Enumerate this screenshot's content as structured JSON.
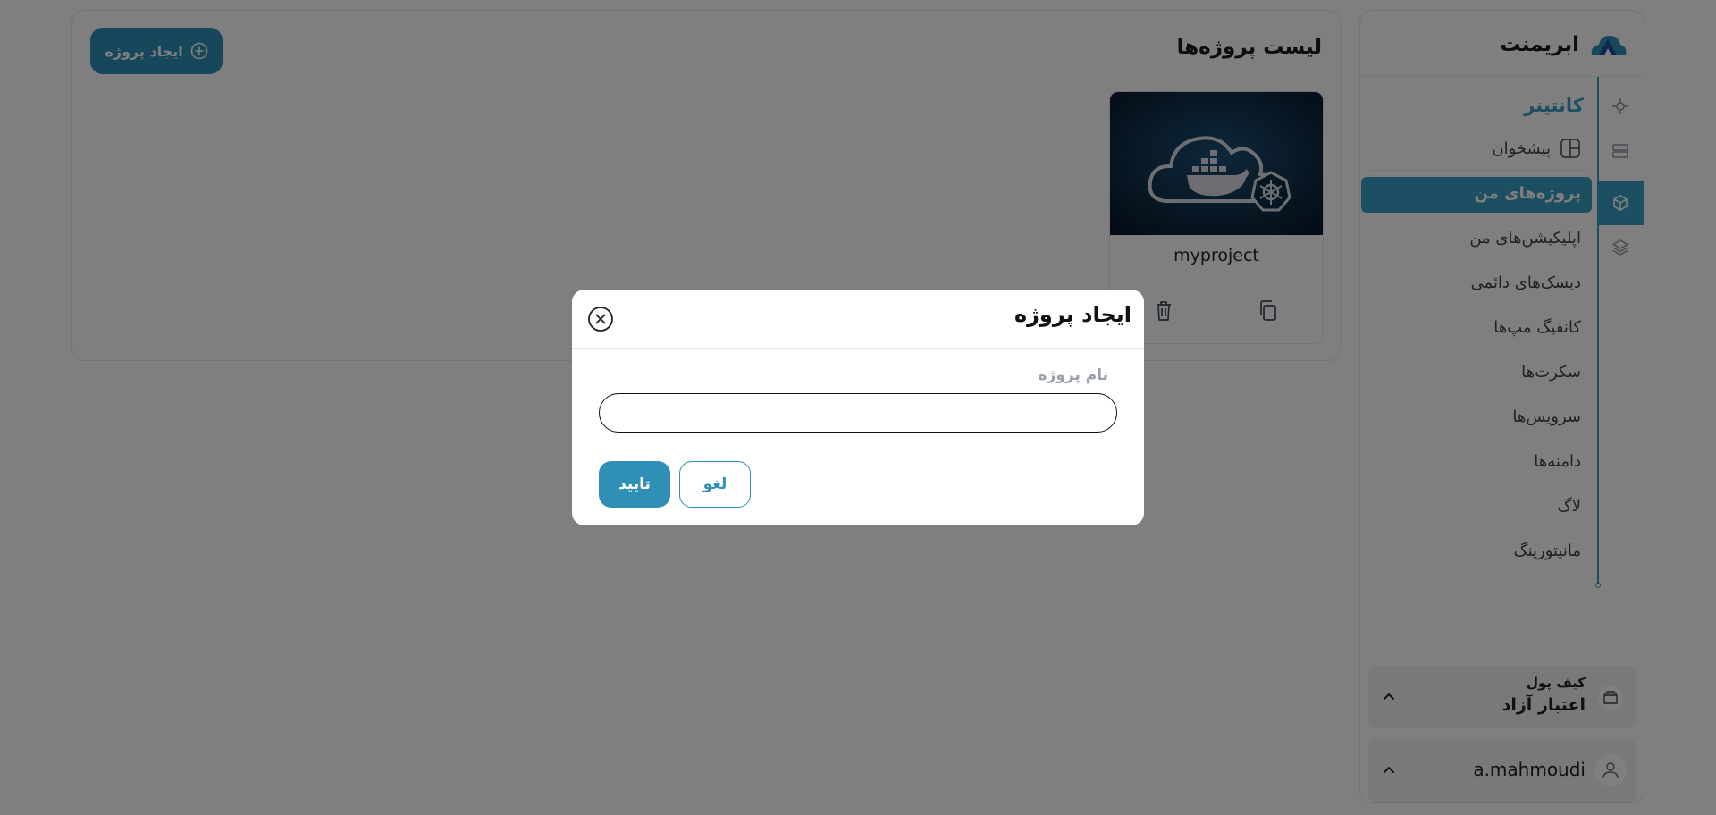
{
  "brand": {
    "name": "ابریمنت",
    "logo_icon": "abriment-logo-icon"
  },
  "colors": {
    "accent": "#3a9ec5",
    "button": "#2f8fb4",
    "overlay": "rgba(0,0,0,0.5)"
  },
  "sidebar": {
    "section_title": "کانتینر",
    "items": [
      {
        "label": "پیشخوان",
        "icon": "dashboard-icon"
      },
      {
        "label": "پروژه‌های من",
        "active": true
      },
      {
        "label": "اپلیکیشن‌های من"
      },
      {
        "label": "دیسک‌های دائمی"
      },
      {
        "label": "کانفیگ مپ‌ها"
      },
      {
        "label": "سکرت‌ها"
      },
      {
        "label": "سرویس‌ها"
      },
      {
        "label": "دامنه‌ها"
      },
      {
        "label": "لاگ"
      },
      {
        "label": "مانیتورینگ"
      }
    ],
    "rail_icons": [
      "kubernetes-icon",
      "server-icon",
      "cube-icon",
      "layers-icon"
    ],
    "wallet": {
      "title": "کیف پول",
      "value": "اعتبار آزاد",
      "icon": "wallet-icon"
    },
    "user": {
      "name": "a.mahmoudi",
      "icon": "user-icon"
    }
  },
  "main": {
    "title": "لیست پروژه‌ها",
    "create_button": "ایجاد پروژه",
    "projects": [
      {
        "name": "myproject"
      }
    ]
  },
  "modal": {
    "title": "ایجاد پروژه",
    "field_label": "نام پروژه",
    "field_value": "",
    "confirm": "تایید",
    "cancel": "لغو"
  }
}
